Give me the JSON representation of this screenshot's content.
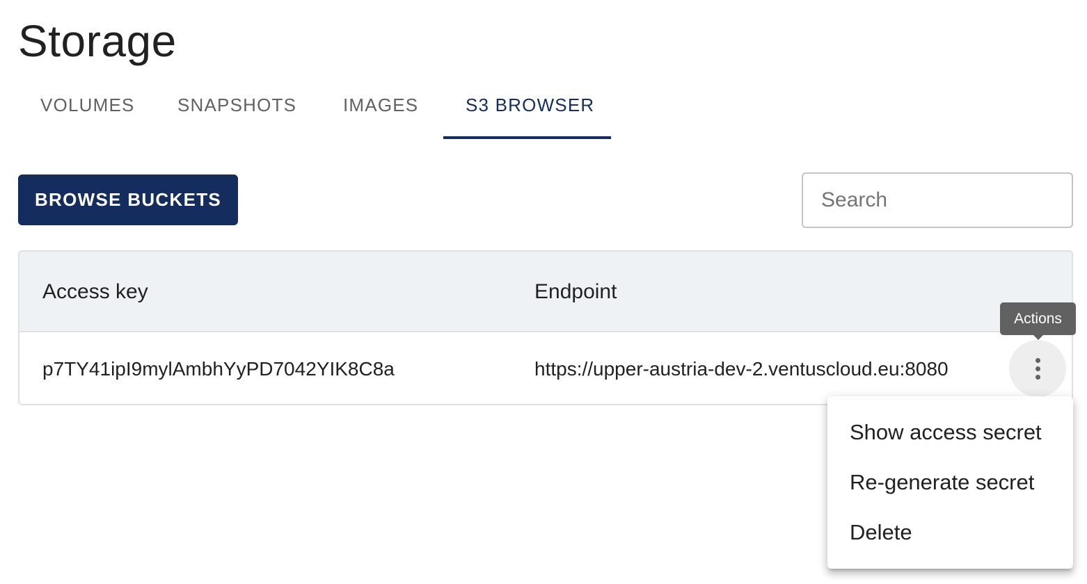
{
  "page": {
    "title": "Storage"
  },
  "tabs": [
    {
      "label": "VOLUMES"
    },
    {
      "label": "SNAPSHOTS"
    },
    {
      "label": "IMAGES"
    },
    {
      "label": "S3 BROWSER",
      "active": true
    }
  ],
  "toolbar": {
    "browse_label": "BROWSE BUCKETS",
    "search_placeholder": "Search"
  },
  "table": {
    "headers": [
      "Access key",
      "Endpoint"
    ],
    "rows": [
      {
        "access_key": "p7TY41ipI9mylAmbhYyPD7042YIK8C8a",
        "endpoint": "https://upper-austria-dev-2.ventuscloud.eu:8080"
      }
    ]
  },
  "actions": {
    "tooltip": "Actions",
    "icon": "more-vert-icon",
    "menu": [
      {
        "label": "Show access secret"
      },
      {
        "label": "Re-generate secret"
      },
      {
        "label": "Delete"
      }
    ]
  },
  "colors": {
    "primary": "#142d5e",
    "header_bg": "#eef2f5",
    "tooltip_bg": "#616161"
  }
}
